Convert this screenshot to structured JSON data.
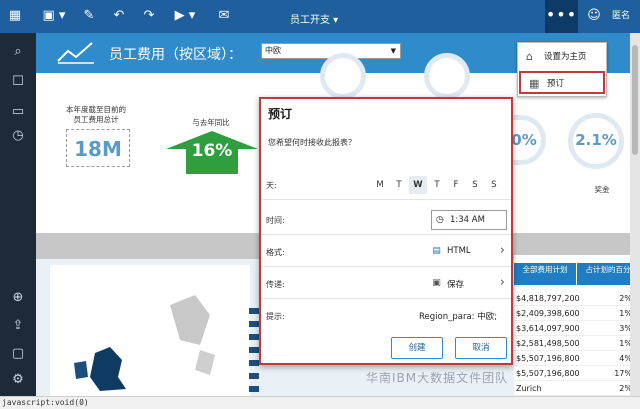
{
  "topbar": {
    "title": "员工开支",
    "user_label": "匿名",
    "more_label": "•••"
  },
  "header": {
    "title": "员工费用（按区域）：",
    "region_select_value": "中欧"
  },
  "kpis": {
    "ytd_label_1": "本年度截至目前的",
    "ytd_label_2": "员工费用总计",
    "ytd_value": "18M",
    "yoy_label": "与去年同比",
    "yoy_value": "16%",
    "ring3_value": "0%",
    "ring4_value": "2.1%",
    "bonus_label": "奖金"
  },
  "table": {
    "col1_header": "全部费用计划",
    "col2_header": "占计划的百分比",
    "rows": [
      {
        "a": "$4,818,797,200",
        "b": "2%"
      },
      {
        "a": "$2,409,398,600",
        "b": "1%"
      },
      {
        "a": "$3,614,097,900",
        "b": "3%"
      },
      {
        "a": "$2,581,498,500",
        "b": "1%"
      },
      {
        "a": "$5,507,196,800",
        "b": "4%"
      },
      {
        "a": "$5,507,196,800",
        "b": "17%"
      },
      {
        "a": "Zurich",
        "b": "2%"
      }
    ]
  },
  "menu": {
    "set_home": "设置为主页",
    "schedule": "预订"
  },
  "dialog": {
    "title": "预订",
    "question": "您希望何时接收此报表？",
    "day_label": "天:",
    "days": [
      "M",
      "T",
      "W",
      "T",
      "F",
      "S",
      "S"
    ],
    "time_label": "时间:",
    "time_value": "1:34 AM",
    "format_label": "格式:",
    "format_value": "HTML",
    "delivery_label": "传递:",
    "delivery_value": "保存",
    "prompt_label": "提示:",
    "prompt_value": "Region_para: 中欧;",
    "create_button": "创建",
    "cancel_button": "取消"
  },
  "status": {
    "url": "javascript:void(0)"
  },
  "watermark": "华南IBM大数据文件团队",
  "colors": {
    "topbar": "#1f5f9e",
    "header": "#2f8bc9",
    "accent_red": "#c0393b",
    "positive_green": "#2e9e3e"
  }
}
